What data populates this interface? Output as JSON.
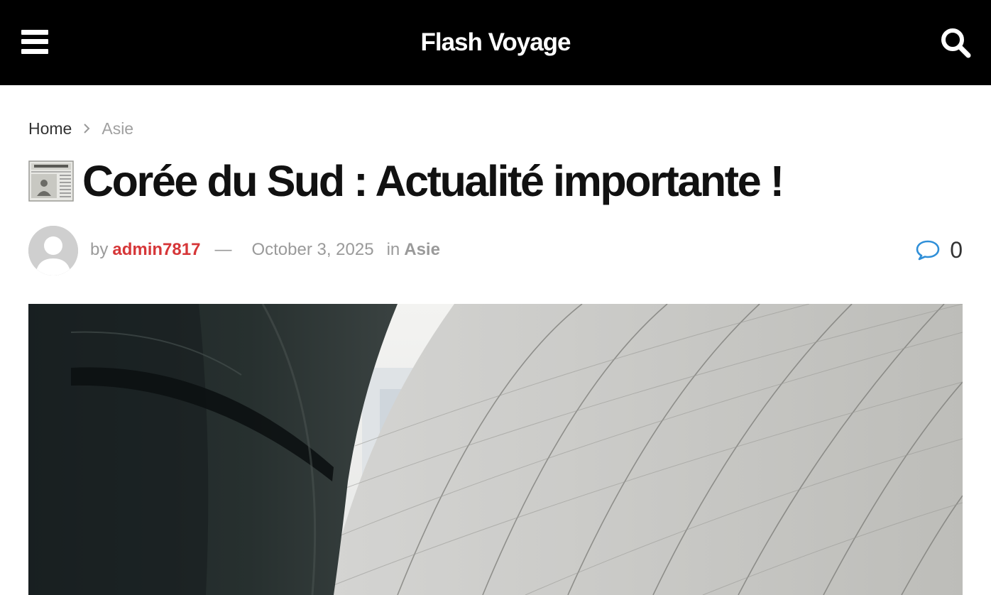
{
  "header": {
    "site_title": "Flash Voyage",
    "menu_icon": "hamburger-menu-icon",
    "search_icon": "search-icon",
    "background_color": "#000000"
  },
  "breadcrumb": {
    "home": "Home",
    "current": "Asie",
    "separator_icon": "chevron-right-icon"
  },
  "post": {
    "title_icon": "newspaper-emoji-icon",
    "title": "Corée du Sud : Actualité importante !",
    "meta": {
      "by_label": "by",
      "author": "admin7817",
      "dash": "—",
      "date": "October 3, 2025",
      "in_label": "in",
      "category": "Asie",
      "comment_icon": "comment-bubble-icon",
      "comment_count": "0"
    },
    "featured_image": "building-facade-image"
  },
  "colors": {
    "author_link": "#d63638",
    "comment_icon": "#2f8fd8",
    "meta_text": "#9a9a9a",
    "title_text": "#111111"
  }
}
